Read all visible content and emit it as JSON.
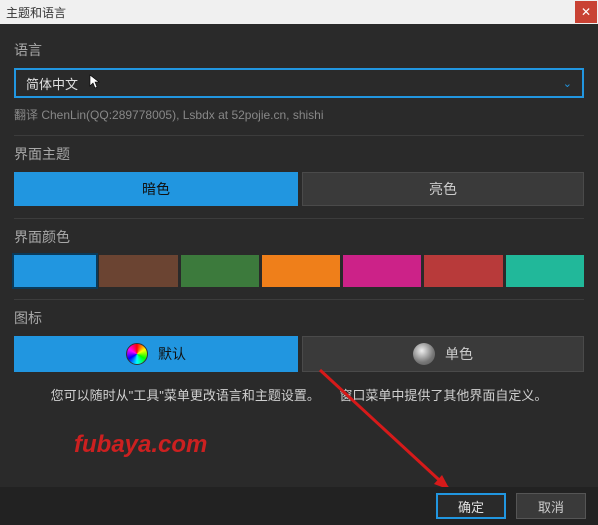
{
  "window": {
    "title": "主题和语言"
  },
  "language": {
    "label": "语言",
    "selected": "简体中文",
    "credits": "翻译 ChenLin(QQ:289778005), Lsbdx at 52pojie.cn, shishi"
  },
  "theme": {
    "label": "界面主题",
    "dark": "暗色",
    "light": "亮色"
  },
  "colors": {
    "label": "界面颜色",
    "swatches": [
      "#2196e0",
      "#6b4432",
      "#3c7a3c",
      "#ef7f1a",
      "#cc2288",
      "#b83a3a",
      "#21b89a"
    ]
  },
  "icons": {
    "label": "图标",
    "default": "默认",
    "mono": "单色"
  },
  "hint": "您可以随时从\"工具\"菜单更改语言和主题设置。　　窗口菜单中提供了其他界面自定义。",
  "watermark": "fubaya.com",
  "buttons": {
    "ok": "确定",
    "cancel": "取消"
  }
}
